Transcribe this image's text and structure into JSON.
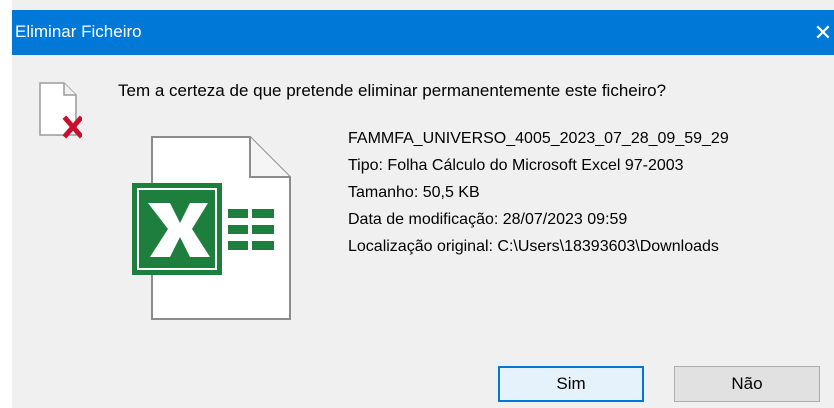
{
  "window": {
    "title": "Eliminar Ficheiro",
    "close_glyph": "✕"
  },
  "dialog": {
    "question": "Tem a certeza de que pretende eliminar permanentemente este ficheiro?",
    "icons": {
      "warning": "file-delete-icon",
      "file": "excel-file-icon"
    },
    "file": {
      "name": "FAMMFA_UNIVERSO_4005_2023_07_28_09_59_29",
      "type": "Tipo: Folha Cálculo do Microsoft Excel 97-2003",
      "size": "Tamanho: 50,5 KB",
      "modified": "Data de modificação: 28/07/2023 09:59",
      "location": "Localização original: C:\\Users\\18393603\\Downloads"
    },
    "buttons": {
      "yes": "Sim",
      "no": "Não"
    }
  },
  "colors": {
    "titlebar": "#0078d7",
    "excel_green": "#1e7e3e",
    "delete_red": "#c8102e"
  }
}
